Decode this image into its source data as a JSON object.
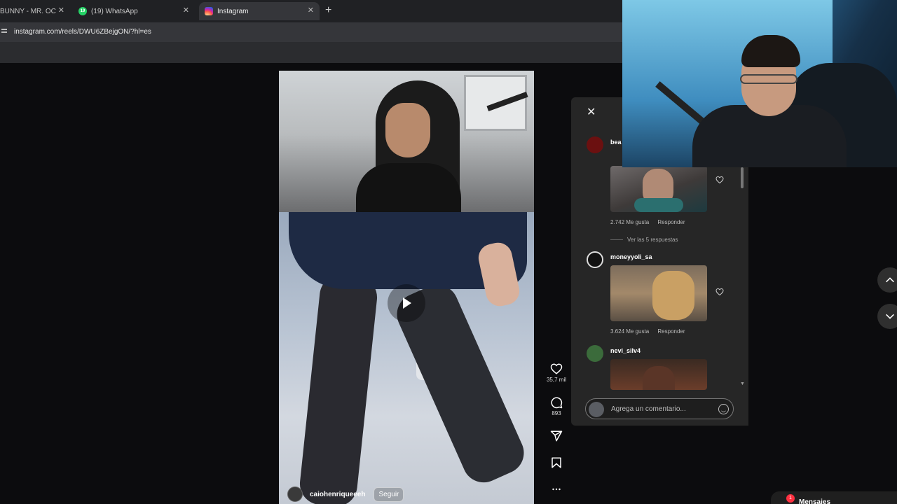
{
  "browser": {
    "tabs": [
      {
        "label": "BUNNY - MR. OCTO",
        "active": false
      },
      {
        "label": "(19) WhatsApp",
        "active": false,
        "favicon_text": "19"
      },
      {
        "label": "Instagram",
        "active": true
      }
    ],
    "url": "instagram.com/reels/DWU6ZBejgON/?hl=es"
  },
  "reel": {
    "author": "caiohenriqueeeh",
    "follow_label": "Seguir",
    "likes": "35,7 mil",
    "comments_count": "893"
  },
  "comments_panel": {
    "input_placeholder": "Agrega un comentario...",
    "items": [
      {
        "user": "bea",
        "likes": "2.742 Me gusta",
        "reply": "Responder",
        "view_replies": "Ver las 5 respuestas"
      },
      {
        "user": "moneyyoli_sa",
        "likes": "3.624 Me gusta",
        "reply": "Responder"
      },
      {
        "user": "nevi_silv4"
      }
    ]
  },
  "footer": {
    "messages_label": "Mensajes",
    "messages_badge": "1"
  },
  "colors": {
    "page_bg": "#0c0c0e",
    "panel_bg": "#262626",
    "badge_red": "#ff3040"
  }
}
